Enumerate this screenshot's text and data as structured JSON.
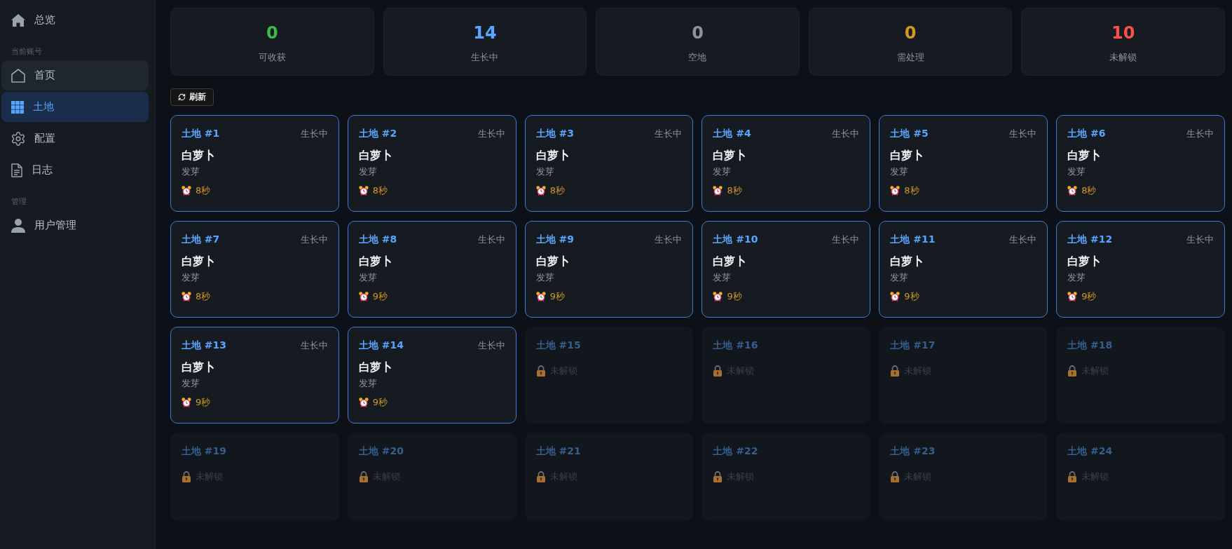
{
  "sidebar": {
    "items": [
      {
        "kind": "link",
        "label": "总览",
        "selected": false,
        "hovered": false
      },
      {
        "kind": "heading",
        "label": "当前账号"
      },
      {
        "kind": "link",
        "label": "首页",
        "selected": false,
        "hovered": true
      },
      {
        "kind": "link",
        "label": "土地",
        "selected": true,
        "hovered": false
      },
      {
        "kind": "link",
        "label": "配置",
        "selected": false,
        "hovered": false
      },
      {
        "kind": "link",
        "label": "日志",
        "selected": false,
        "hovered": false
      },
      {
        "kind": "heading",
        "label": "管理"
      },
      {
        "kind": "link",
        "label": "用户管理",
        "selected": false,
        "hovered": false
      }
    ]
  },
  "stats": [
    {
      "value": "0",
      "label": "可收获",
      "color": "#3fb950"
    },
    {
      "value": "14",
      "label": "生长中",
      "color": "#58a6ff"
    },
    {
      "value": "0",
      "label": "空地",
      "color": "#8b949e"
    },
    {
      "value": "0",
      "label": "需处理",
      "color": "#d29922"
    },
    {
      "value": "10",
      "label": "未解锁",
      "color": "#f85149"
    }
  ],
  "refresh_button": {
    "label": "刷新"
  },
  "plots": [
    {
      "kind": "growing",
      "title": "土地 #1",
      "status": "生长中",
      "crop": "白萝卜",
      "stage": "发芽",
      "timer": "8秒"
    },
    {
      "kind": "growing",
      "title": "土地 #2",
      "status": "生长中",
      "crop": "白萝卜",
      "stage": "发芽",
      "timer": "8秒"
    },
    {
      "kind": "growing",
      "title": "土地 #3",
      "status": "生长中",
      "crop": "白萝卜",
      "stage": "发芽",
      "timer": "8秒"
    },
    {
      "kind": "growing",
      "title": "土地 #4",
      "status": "生长中",
      "crop": "白萝卜",
      "stage": "发芽",
      "timer": "8秒"
    },
    {
      "kind": "growing",
      "title": "土地 #5",
      "status": "生长中",
      "crop": "白萝卜",
      "stage": "发芽",
      "timer": "8秒"
    },
    {
      "kind": "growing",
      "title": "土地 #6",
      "status": "生长中",
      "crop": "白萝卜",
      "stage": "发芽",
      "timer": "8秒"
    },
    {
      "kind": "growing",
      "title": "土地 #7",
      "status": "生长中",
      "crop": "白萝卜",
      "stage": "发芽",
      "timer": "8秒"
    },
    {
      "kind": "growing",
      "title": "土地 #8",
      "status": "生长中",
      "crop": "白萝卜",
      "stage": "发芽",
      "timer": "9秒"
    },
    {
      "kind": "growing",
      "title": "土地 #9",
      "status": "生长中",
      "crop": "白萝卜",
      "stage": "发芽",
      "timer": "9秒"
    },
    {
      "kind": "growing",
      "title": "土地 #10",
      "status": "生长中",
      "crop": "白萝卜",
      "stage": "发芽",
      "timer": "9秒"
    },
    {
      "kind": "growing",
      "title": "土地 #11",
      "status": "生长中",
      "crop": "白萝卜",
      "stage": "发芽",
      "timer": "9秒"
    },
    {
      "kind": "growing",
      "title": "土地 #12",
      "status": "生长中",
      "crop": "白萝卜",
      "stage": "发芽",
      "timer": "9秒"
    },
    {
      "kind": "growing",
      "title": "土地 #13",
      "status": "生长中",
      "crop": "白萝卜",
      "stage": "发芽",
      "timer": "9秒"
    },
    {
      "kind": "growing",
      "title": "土地 #14",
      "status": "生长中",
      "crop": "白萝卜",
      "stage": "发芽",
      "timer": "9秒"
    },
    {
      "kind": "locked",
      "title": "土地 #15",
      "lock_label": "未解锁"
    },
    {
      "kind": "locked",
      "title": "土地 #16",
      "lock_label": "未解锁"
    },
    {
      "kind": "locked",
      "title": "土地 #17",
      "lock_label": "未解锁"
    },
    {
      "kind": "locked",
      "title": "土地 #18",
      "lock_label": "未解锁"
    },
    {
      "kind": "locked",
      "title": "土地 #19",
      "lock_label": "未解锁"
    },
    {
      "kind": "locked",
      "title": "土地 #20",
      "lock_label": "未解锁"
    },
    {
      "kind": "locked",
      "title": "土地 #21",
      "lock_label": "未解锁"
    },
    {
      "kind": "locked",
      "title": "土地 #22",
      "lock_label": "未解锁"
    },
    {
      "kind": "locked",
      "title": "土地 #23",
      "lock_label": "未解锁"
    },
    {
      "kind": "locked",
      "title": "土地 #24",
      "lock_label": "未解锁"
    }
  ]
}
